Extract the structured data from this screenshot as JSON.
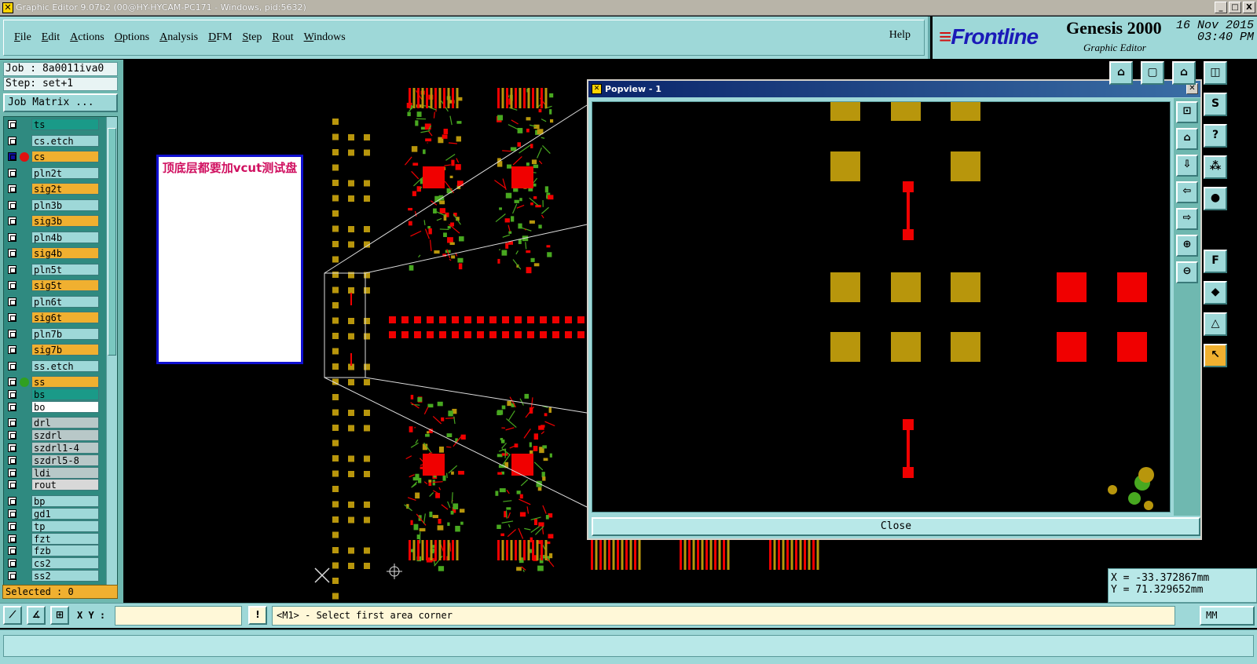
{
  "window": {
    "title": "Graphic Editor 9.07b2 (00@HY-HYCAM-PC171 - Windows, pid:5632)",
    "min": "_",
    "max": "□",
    "close": "X"
  },
  "menu": [
    {
      "label": "File",
      "accel": "F"
    },
    {
      "label": "Edit",
      "accel": "E"
    },
    {
      "label": "Actions",
      "accel": "A"
    },
    {
      "label": "Options",
      "accel": "O"
    },
    {
      "label": "Analysis",
      "accel": "A"
    },
    {
      "label": "DFM",
      "accel": "D"
    },
    {
      "label": "Step",
      "accel": "S"
    },
    {
      "label": "Rout",
      "accel": "R"
    },
    {
      "label": "Windows",
      "accel": "W"
    }
  ],
  "help_label": "Help",
  "brand": {
    "logo": "Frontline",
    "product": "Genesis 2000",
    "subtitle": "Graphic Editor",
    "date": "16 Nov 2015",
    "time": "03:40 PM"
  },
  "job": "Job : 8a0011iva0",
  "step": "Step: set+1",
  "job_matrix_label": "Job Matrix ...",
  "layers": [
    {
      "name": "ts",
      "color": "#1a9a88",
      "dot": ""
    },
    {
      "name": "cs.etch",
      "color": "#9ed8d8",
      "dot": ""
    },
    {
      "name": "cs",
      "color": "#f0b030",
      "dot": "#e01010",
      "active": true
    },
    {
      "name": "pln2t",
      "color": "#9ed8d8",
      "dot": ""
    },
    {
      "name": "sig2t",
      "color": "#f0b030",
      "dot": ""
    },
    {
      "name": "pln3b",
      "color": "#9ed8d8",
      "dot": ""
    },
    {
      "name": "sig3b",
      "color": "#f0b030",
      "dot": ""
    },
    {
      "name": "pln4b",
      "color": "#9ed8d8",
      "dot": ""
    },
    {
      "name": "sig4b",
      "color": "#f0b030",
      "dot": ""
    },
    {
      "name": "pln5t",
      "color": "#9ed8d8",
      "dot": ""
    },
    {
      "name": "sig5t",
      "color": "#f0b030",
      "dot": ""
    },
    {
      "name": "pln6t",
      "color": "#9ed8d8",
      "dot": ""
    },
    {
      "name": "sig6t",
      "color": "#f0b030",
      "dot": ""
    },
    {
      "name": "pln7b",
      "color": "#9ed8d8",
      "dot": ""
    },
    {
      "name": "sig7b",
      "color": "#f0b030",
      "dot": ""
    },
    {
      "name": "ss.etch",
      "color": "#9ed8d8",
      "dot": ""
    },
    {
      "name": "ss",
      "color": "#f0b030",
      "dot": "#30a020"
    },
    {
      "name": "bs",
      "color": "#1a9a88",
      "dot": ""
    },
    {
      "name": "bo",
      "color": "#ffffff",
      "dot": ""
    },
    {
      "name": "drl",
      "color": "#b8c8c8",
      "dot": ""
    },
    {
      "name": "szdrl",
      "color": "#b8c8c8",
      "dot": ""
    },
    {
      "name": "szdrl1-4",
      "color": "#b8c8c8",
      "dot": ""
    },
    {
      "name": "szdrl5-8",
      "color": "#b8c8c8",
      "dot": ""
    },
    {
      "name": "ldi",
      "color": "#b8c8c8",
      "dot": ""
    },
    {
      "name": "rout",
      "color": "#d8d8d8",
      "dot": ""
    },
    {
      "name": "bp",
      "color": "#9ed8d8",
      "dot": ""
    },
    {
      "name": "gd1",
      "color": "#9ed8d8",
      "dot": ""
    },
    {
      "name": "tp",
      "color": "#9ed8d8",
      "dot": ""
    },
    {
      "name": "fzt",
      "color": "#9ed8d8",
      "dot": ""
    },
    {
      "name": "fzb",
      "color": "#9ed8d8",
      "dot": ""
    },
    {
      "name": "cs2",
      "color": "#9ed8d8",
      "dot": ""
    },
    {
      "name": "ss2",
      "color": "#9ed8d8",
      "dot": ""
    }
  ],
  "selected": "Selected : 0",
  "note_text": "顶底层都要加vcut测试盘",
  "popview": {
    "title": "Popview - 1",
    "close_label": "Close"
  },
  "coords": {
    "x": "X = -33.372867mm",
    "y": "Y = 71.329652mm"
  },
  "bottom": {
    "xy_label": "X Y :",
    "xy_value": "",
    "prompt": "<M1> - Select first area corner",
    "units": "MM"
  },
  "colors": {
    "pad_gold": "#b8960c",
    "pad_red": "#f00000",
    "trace_green": "#48a820"
  }
}
